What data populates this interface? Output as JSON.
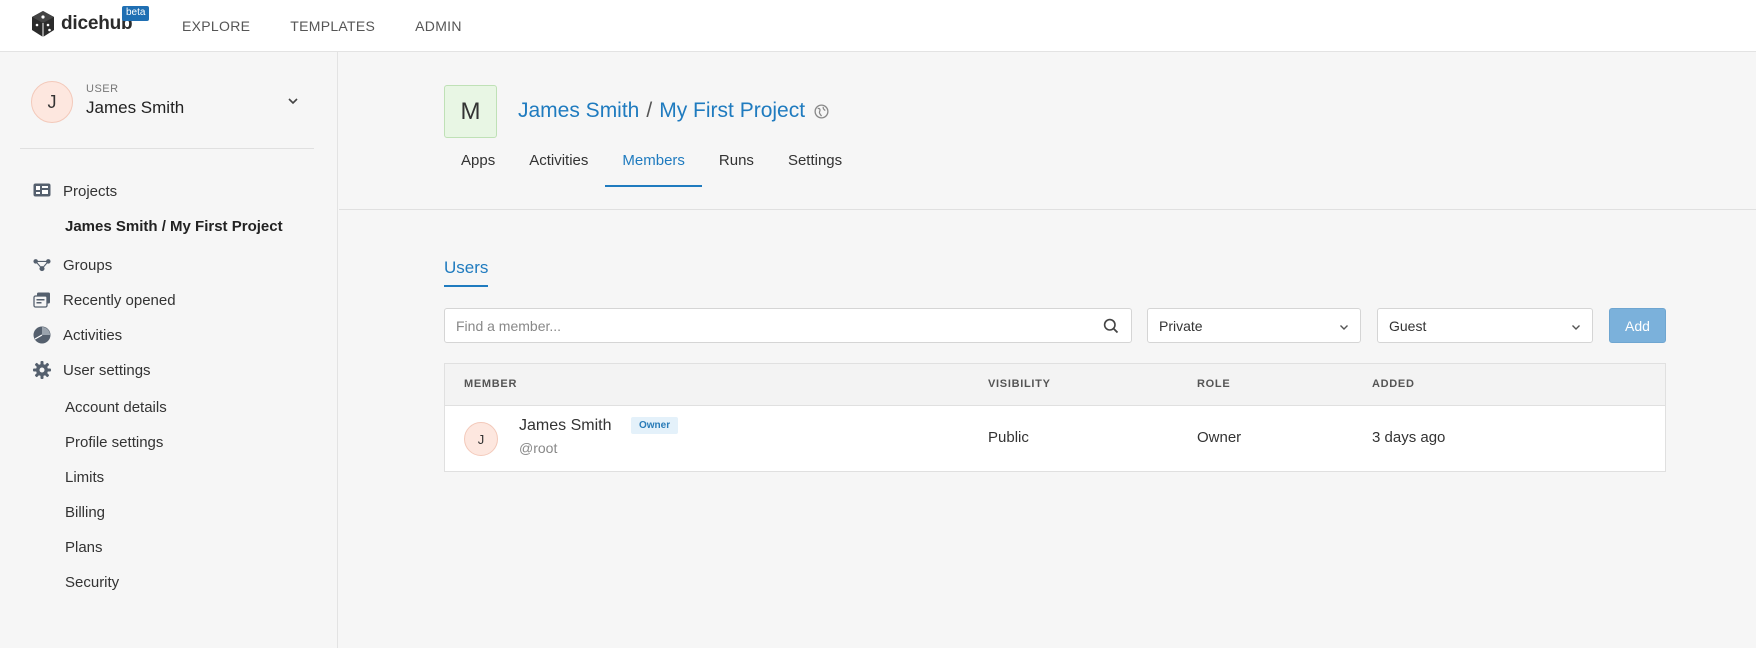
{
  "brand": {
    "name": "dicehub",
    "badge": "beta"
  },
  "topnav": [
    "EXPLORE",
    "TEMPLATES",
    "ADMIN"
  ],
  "user": {
    "initial": "J",
    "caption": "USER",
    "name": "James Smith"
  },
  "sidebar": {
    "projects": "Projects",
    "current_project": "James Smith / My First Project",
    "groups": "Groups",
    "recent": "Recently opened",
    "activities": "Activities",
    "user_settings": "User settings",
    "settings_items": [
      "Account details",
      "Profile settings",
      "Limits",
      "Billing",
      "Plans",
      "Security"
    ]
  },
  "project": {
    "initial": "M",
    "owner": "James Smith",
    "separator": "/",
    "name": "My First Project"
  },
  "tabs": [
    "Apps",
    "Activities",
    "Members",
    "Runs",
    "Settings"
  ],
  "active_tab": "Members",
  "members": {
    "subtab": "Users",
    "search_placeholder": "Find a member...",
    "visibility_select": "Private",
    "role_select": "Guest",
    "add_label": "Add",
    "columns": [
      "MEMBER",
      "VISIBILITY",
      "ROLE",
      "ADDED"
    ],
    "rows": [
      {
        "initial": "J",
        "name": "James Smith",
        "badge": "Owner",
        "handle": "@root",
        "visibility": "Public",
        "role": "Owner",
        "added": "3 days ago"
      }
    ]
  },
  "colors": {
    "accent": "#1f7bbf",
    "add_button": "#7bb1db",
    "avatar_bg": "#fde7df",
    "project_avatar_bg": "#e8f6e4"
  }
}
